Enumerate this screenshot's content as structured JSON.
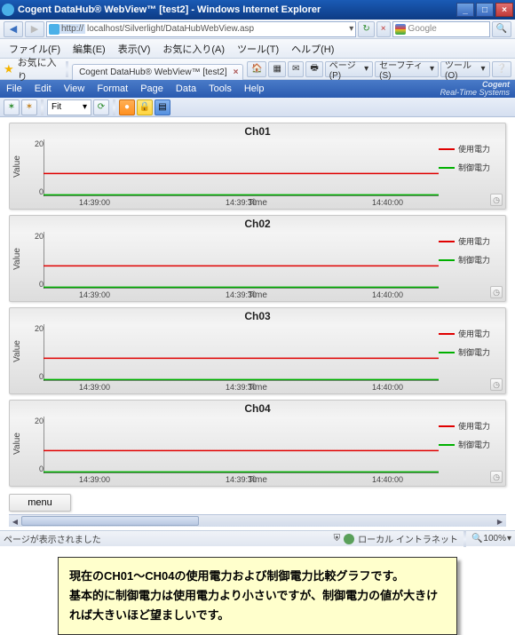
{
  "window": {
    "title": "Cogent DataHub® WebView™ [test2] - Windows Internet Explorer",
    "minimize": "_",
    "maximize": "□",
    "close": "×"
  },
  "ie": {
    "url_scheme": "http://",
    "url_rest": "localhost/Silverlight/DataHubWebView.asp",
    "search_provider": "Google",
    "refresh": "↻",
    "stop": "×",
    "search_icon": "🔍",
    "dropdown": "▾",
    "menus": {
      "file": "ファイル(F)",
      "edit": "編集(E)",
      "view": "表示(V)",
      "favorites": "お気に入り(A)",
      "tools": "ツール(T)",
      "help": "ヘルプ(H)"
    },
    "fav_label": "お気に入り",
    "tab_title": "Cogent DataHub® WebView™ [test2]",
    "commandbar": {
      "home": "🏠",
      "feeds": "▦",
      "mail": "✉",
      "print": "🖶",
      "page": "ページ(P)",
      "safety": "セーフティ(S)",
      "tools": "ツール(O)",
      "help": "❔"
    }
  },
  "app": {
    "menus": {
      "file": "File",
      "edit": "Edit",
      "view": "View",
      "format": "Format",
      "page": "Page",
      "data": "Data",
      "tools": "Tools",
      "help": "Help"
    },
    "brand_top": "Cogent",
    "brand_bottom": "Real-Time Systems",
    "toolbar": {
      "fit": "Fit",
      "down": "▾"
    }
  },
  "charts": [
    {
      "title": "Ch01"
    },
    {
      "title": "Ch02"
    },
    {
      "title": "Ch03"
    },
    {
      "title": "Ch04"
    }
  ],
  "chart_common": {
    "ylabel": "Value",
    "xlabel": "Time",
    "yticks": [
      "20",
      "0"
    ],
    "xticks": [
      "14:39:00",
      "14:39:30",
      "14:40:00"
    ],
    "legend": [
      {
        "label": "使用電力",
        "color": "#e00000"
      },
      {
        "label": "制御電力",
        "color": "#00b000"
      }
    ],
    "clock_icon": "◷"
  },
  "chart_data": [
    {
      "type": "line",
      "title": "Ch01",
      "xlabel": "Time",
      "ylabel": "Value",
      "ylim": [
        0,
        20
      ],
      "x": [
        "14:39:00",
        "14:39:30",
        "14:40:00"
      ],
      "series": [
        {
          "name": "使用電力",
          "color": "#e00000",
          "values": [
            8,
            8,
            8
          ]
        },
        {
          "name": "制御電力",
          "color": "#00b000",
          "values": [
            0.5,
            0.5,
            0.5
          ]
        }
      ]
    },
    {
      "type": "line",
      "title": "Ch02",
      "xlabel": "Time",
      "ylabel": "Value",
      "ylim": [
        0,
        20
      ],
      "x": [
        "14:39:00",
        "14:39:30",
        "14:40:00"
      ],
      "series": [
        {
          "name": "使用電力",
          "color": "#e00000",
          "values": [
            8,
            8,
            8
          ]
        },
        {
          "name": "制御電力",
          "color": "#00b000",
          "values": [
            0.5,
            0.5,
            0.5
          ]
        }
      ]
    },
    {
      "type": "line",
      "title": "Ch03",
      "xlabel": "Time",
      "ylabel": "Value",
      "ylim": [
        0,
        20
      ],
      "x": [
        "14:39:00",
        "14:39:30",
        "14:40:00"
      ],
      "series": [
        {
          "name": "使用電力",
          "color": "#e00000",
          "values": [
            8,
            8,
            8
          ]
        },
        {
          "name": "制御電力",
          "color": "#00b000",
          "values": [
            0.5,
            0.5,
            0.5
          ]
        }
      ]
    },
    {
      "type": "line",
      "title": "Ch04",
      "xlabel": "Time",
      "ylabel": "Value",
      "ylim": [
        0,
        20
      ],
      "x": [
        "14:39:00",
        "14:39:30",
        "14:40:00"
      ],
      "series": [
        {
          "name": "使用電力",
          "color": "#e00000",
          "values": [
            8,
            8,
            8
          ]
        },
        {
          "name": "制御電力",
          "color": "#00b000",
          "values": [
            0.5,
            0.5,
            0.5
          ]
        }
      ]
    }
  ],
  "menu_button": "menu",
  "status": {
    "left": "ページが表示されました",
    "zone": "ローカル イントラネット",
    "protected": "⛨",
    "zoom": "100%",
    "zoom_down": "▾"
  },
  "callout": {
    "line1": "現在のCH01～CH04の使用電力および制御電力比較グラフです。",
    "line2": "基本的に制御電力は使用電力より小さいですが、制御電力の値が大きければ大きいほど望ましいです。"
  }
}
